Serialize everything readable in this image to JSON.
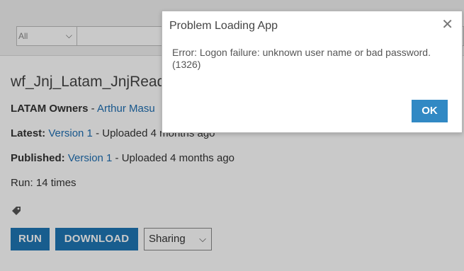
{
  "toolbar": {
    "scope_select_value": "All",
    "search_value": ""
  },
  "app": {
    "title": "wf_Jnj_Latam_JnjRead",
    "owners_label": "LATAM Owners",
    "owners_separator": " - ",
    "owner_name": "Arthur Masu",
    "latest_label": "Latest:",
    "latest_version": "Version 1",
    "latest_uploaded": " - Uploaded 4 months ago",
    "published_label": "Published:",
    "published_version": "Version 1",
    "published_uploaded": " - Uploaded 4 months ago",
    "runs_text": "Run: 14 times"
  },
  "actions": {
    "run_label": "RUN",
    "download_label": "DOWNLOAD",
    "sharing_label": "Sharing"
  },
  "dialog": {
    "title": "Problem Loading App",
    "close_symbol": "✕",
    "message": "Error: Logon failure: unknown user name or bad password. (1326)",
    "ok_label": "OK"
  },
  "colors": {
    "primary_button": "#1f77b4",
    "link": "#1f6fb2",
    "ok_button": "#3189c4"
  }
}
